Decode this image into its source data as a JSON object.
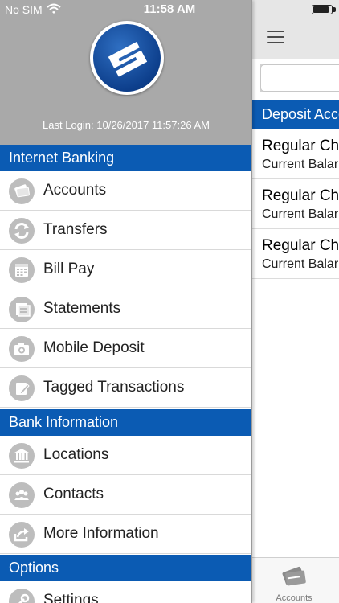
{
  "status_bar": {
    "carrier": "No SIM",
    "time": "11:58 AM",
    "battery_level": 0.9
  },
  "drawer": {
    "last_login": "Last Login: 10/26/2017 11:57:26 AM",
    "sections": [
      {
        "title": "Internet Banking",
        "items": [
          {
            "label": "Accounts",
            "icon": "credit-card-icon"
          },
          {
            "label": "Transfers",
            "icon": "transfer-arrows-icon"
          },
          {
            "label": "Bill Pay",
            "icon": "calendar-icon"
          },
          {
            "label": "Statements",
            "icon": "statement-icon"
          },
          {
            "label": "Mobile Deposit",
            "icon": "camera-icon"
          },
          {
            "label": "Tagged Transactions",
            "icon": "tag-pencil-icon"
          }
        ]
      },
      {
        "title": "Bank Information",
        "items": [
          {
            "label": "Locations",
            "icon": "bank-building-icon"
          },
          {
            "label": "Contacts",
            "icon": "people-icon"
          },
          {
            "label": "More Information",
            "icon": "share-arrow-icon"
          }
        ]
      },
      {
        "title": "Options",
        "items": [
          {
            "label": "Settings",
            "icon": "wrench-icon"
          }
        ]
      }
    ]
  },
  "main": {
    "section_title": "Deposit Acco",
    "accounts": [
      {
        "name": "Regular Ch",
        "balance_label": "Current Balar"
      },
      {
        "name": "Regular Ch",
        "balance_label": "Current Balar"
      },
      {
        "name": "Regular Ch",
        "balance_label": "Current Balar"
      }
    ],
    "tab_bar": {
      "accounts_label": "Accounts"
    }
  },
  "colors": {
    "section_blue": "#0b5bb3",
    "header_gray": "#a9a9a9",
    "icon_gray": "#bdbdbd"
  }
}
